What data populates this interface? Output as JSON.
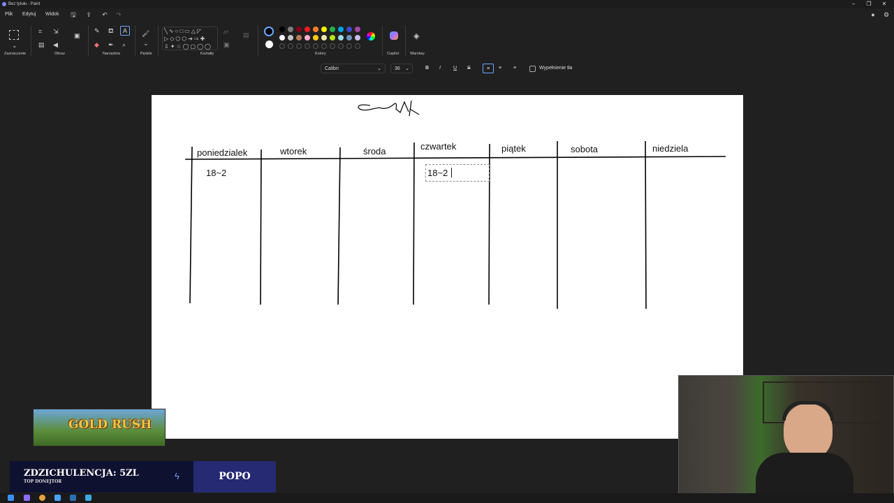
{
  "window": {
    "title": "Bez tytułu - Paint"
  },
  "menu": {
    "file": "Plik",
    "edit": "Edytuj",
    "view": "Widok"
  },
  "groups": {
    "selection": "Zaznaczenie",
    "image": "Obraz",
    "tools": "Narzędzia",
    "brushes": "Pędzle",
    "shapes": "Kształty",
    "colors": "Kolory",
    "copilot": "Copilot",
    "layers": "Warstwy"
  },
  "format": {
    "font": "Calibri",
    "size": "36",
    "fill_bg": "Wypełnienie tła"
  },
  "colors": {
    "row1": [
      "#000000",
      "#7f7f7f",
      "#880015",
      "#ed1c24",
      "#ff7f27",
      "#fff200",
      "#22b14c",
      "#00a2e8",
      "#3f48cc",
      "#a349a4"
    ],
    "row2": [
      "#ffffff",
      "#c3c3c3",
      "#b97a57",
      "#ffaec9",
      "#ffc90e",
      "#efe4b0",
      "#b5e61d",
      "#99d9ea",
      "#7092be",
      "#c8bfe7"
    ]
  },
  "canvas": {
    "days": [
      "poniedzialek",
      "wtorek",
      "środa",
      "czwartek",
      "piątek",
      "sobota",
      "niedziela"
    ],
    "cell_mon": "18~2",
    "cell_thu": "18~2"
  },
  "overlay": {
    "promo": "GOLD RUSH",
    "donor_name": "ZDZICHULENCJA: 5ZL",
    "donor_sub": "TOP DONEJTOR",
    "right_label": "POPO"
  }
}
